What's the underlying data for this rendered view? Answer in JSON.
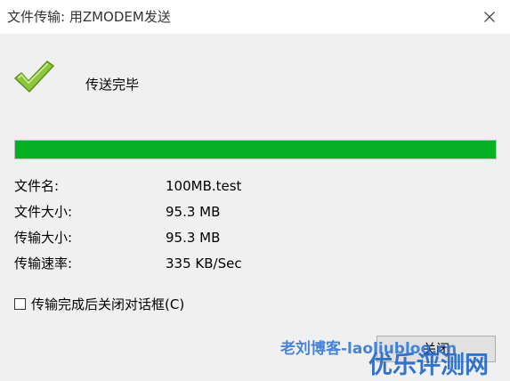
{
  "window": {
    "title": "文件传输: 用ZMODEM发送"
  },
  "status": {
    "text": "传送完毕",
    "icon": "checkmark-icon"
  },
  "progress": {
    "percent": 100,
    "color": "#06b025"
  },
  "info": [
    {
      "label": "文件名:",
      "value": "100MB.test"
    },
    {
      "label": "文件大小:",
      "value": "95.3 MB"
    },
    {
      "label": "传输大小:",
      "value": "95.3 MB"
    },
    {
      "label": "传输速率:",
      "value": "335 KB/Sec"
    }
  ],
  "options": {
    "autoclose_label": "传输完成后关闭对话框(C)",
    "autoclose_checked": false
  },
  "actions": {
    "close_label": "关闭"
  },
  "watermarks": {
    "line1": "老刘博客-laoliublog.cn",
    "line2": "优乐评测网"
  },
  "colors": {
    "progress_fill": "#06b025",
    "check_green": "#8cc63f"
  }
}
